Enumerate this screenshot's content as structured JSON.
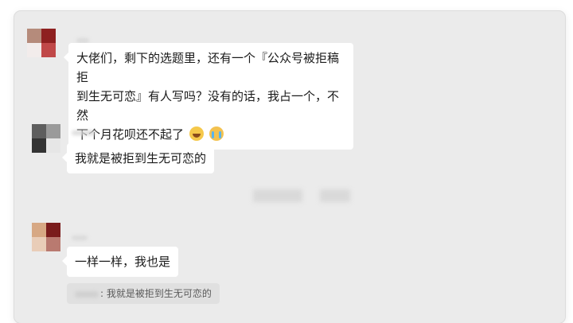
{
  "messages": [
    {
      "text_line1": "大佬们，剩下的选题里，还有一个『公众号被拒稿拒",
      "text_line2": "到生无可恋』有人写吗？没有的话，我占一个，不然",
      "text_line3": "下个月花呗还不起了",
      "emojis": [
        "laughing-crying-emoji",
        "crying-emoji"
      ]
    },
    {
      "text": "我就是被拒到生无可恋的"
    },
    {
      "text": "一样一样，我也是"
    }
  ],
  "quote": {
    "text": ": 我就是被拒到生无可恋的"
  },
  "colors": {
    "background": "#ebebeb",
    "bubble": "#ffffff",
    "quote_bg": "#e0e0e0",
    "text": "#1a1a1a"
  }
}
